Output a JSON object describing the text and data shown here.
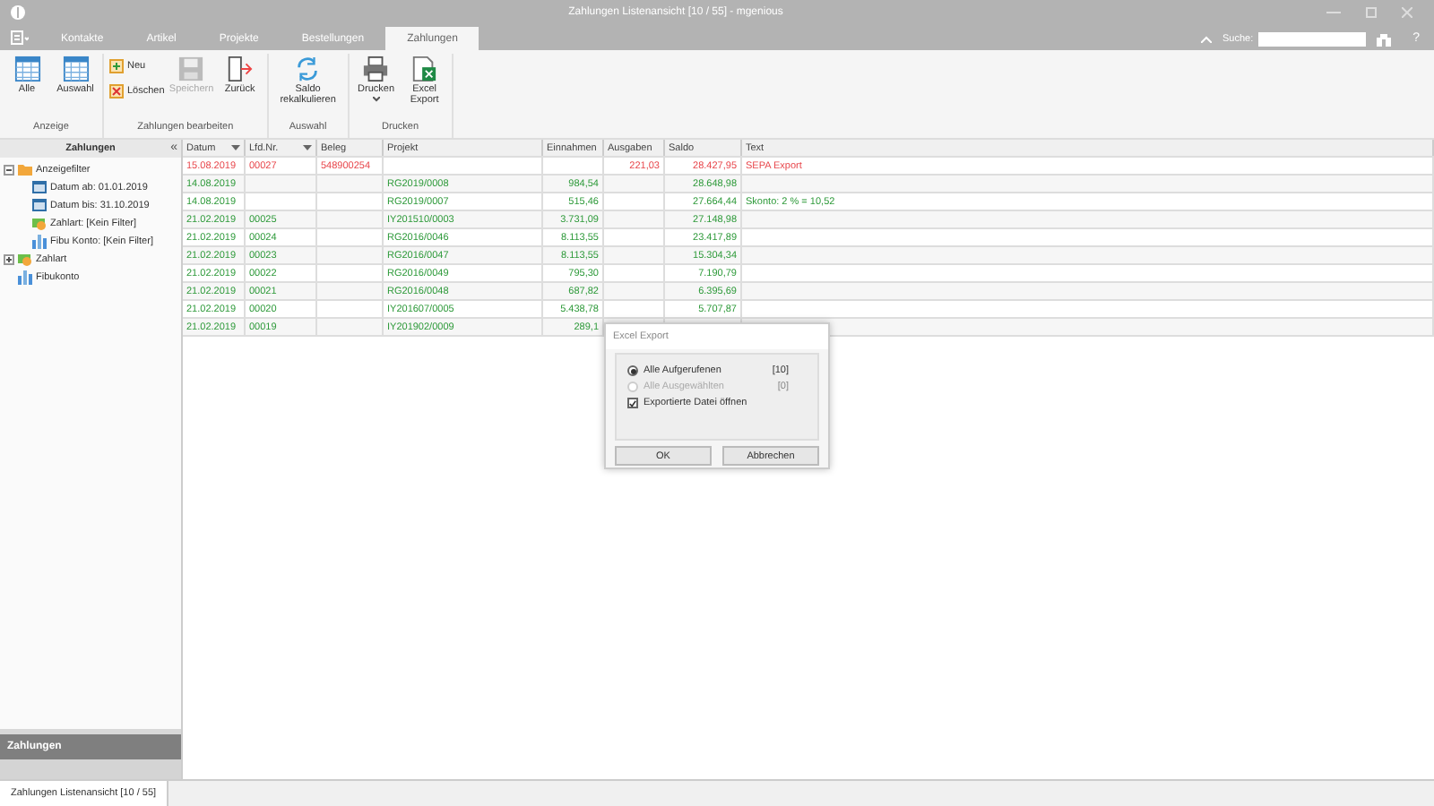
{
  "window": {
    "title": "Zahlungen Listenansicht [10 / 55] - mgenious"
  },
  "menu_tabs": [
    {
      "label": "Kontakte",
      "selected": false
    },
    {
      "label": "Artikel",
      "selected": false
    },
    {
      "label": "Projekte",
      "selected": false
    },
    {
      "label": "Bestellungen",
      "selected": false
    },
    {
      "label": "Zahlungen",
      "selected": true
    }
  ],
  "search": {
    "label": "Suche:"
  },
  "help": "?",
  "ribbon": [
    {
      "label": "Anzeige",
      "buttons": [
        {
          "label": "Alle",
          "kind": "large",
          "disabled": false
        },
        {
          "label": "Auswahl",
          "kind": "large",
          "disabled": false
        }
      ]
    },
    {
      "label": "Zahlungen bearbeiten",
      "buttons": [
        {
          "label": "Neu",
          "kind": "small",
          "disabled": false
        },
        {
          "label": "Löschen",
          "kind": "small",
          "disabled": false
        },
        {
          "label": "Speichern",
          "kind": "large",
          "disabled": true
        },
        {
          "label": "Zurück",
          "kind": "large",
          "disabled": false
        }
      ]
    },
    {
      "label": "Auswahl",
      "buttons": [
        {
          "label": "Saldo rekalkulieren",
          "kind": "large",
          "disabled": false
        }
      ]
    },
    {
      "label": "Drucken",
      "buttons": [
        {
          "label": "Drucken",
          "kind": "large",
          "disabled": false,
          "dropdown": true
        },
        {
          "label": "Excel Export",
          "kind": "large",
          "disabled": false
        }
      ]
    }
  ],
  "sidebar": {
    "title": "Zahlungen",
    "collapse": "«",
    "tree": [
      {
        "label": "Anzeigefilter",
        "expanded": true,
        "children": [
          {
            "label": "Datum ab: 01.01.2019"
          },
          {
            "label": "Datum bis: 31.10.2019"
          },
          {
            "label": "Zahlart: [Kein Filter]"
          },
          {
            "label": "Fibu Konto: [Kein Filter]"
          }
        ]
      },
      {
        "label": "Zahlart",
        "expanded": false
      },
      {
        "label": "Fibukonto"
      }
    ],
    "footer_title": "Zahlungen"
  },
  "table": {
    "columns": [
      {
        "label": "Datum",
        "filter": true
      },
      {
        "label": "Lfd.Nr.",
        "filter": true
      },
      {
        "label": "Beleg",
        "filter": false
      },
      {
        "label": "Projekt",
        "filter": false
      },
      {
        "label": "Einnahmen",
        "filter": false
      },
      {
        "label": "Ausgaben",
        "filter": false
      },
      {
        "label": "Saldo",
        "filter": false
      },
      {
        "label": "Text",
        "filter": false
      }
    ],
    "rows": [
      {
        "color": "#e8474c",
        "cells": [
          "15.08.2019",
          "00027",
          "548900254",
          "",
          "",
          "221,03",
          "28.427,95",
          "SEPA Export"
        ]
      },
      {
        "color": "#2e9a3a",
        "cells": [
          "14.08.2019",
          "",
          "",
          "RG2019/0008",
          "984,54",
          "",
          "28.648,98",
          ""
        ]
      },
      {
        "color": "#2e9a3a",
        "cells": [
          "14.08.2019",
          "",
          "",
          "RG2019/0007",
          "515,46",
          "",
          "27.664,44",
          "Skonto: 2 % = 10,52"
        ]
      },
      {
        "color": "#2e9a3a",
        "cells": [
          "21.02.2019",
          "00025",
          "",
          "IY201510/0003",
          "3.731,09",
          "",
          "27.148,98",
          ""
        ]
      },
      {
        "color": "#2e9a3a",
        "cells": [
          "21.02.2019",
          "00024",
          "",
          "RG2016/0046",
          "8.113,55",
          "",
          "23.417,89",
          ""
        ]
      },
      {
        "color": "#2e9a3a",
        "cells": [
          "21.02.2019",
          "00023",
          "",
          "RG2016/0047",
          "8.113,55",
          "",
          "15.304,34",
          ""
        ]
      },
      {
        "color": "#2e9a3a",
        "cells": [
          "21.02.2019",
          "00022",
          "",
          "RG2016/0049",
          "795,30",
          "",
          "7.190,79",
          ""
        ]
      },
      {
        "color": "#2e9a3a",
        "cells": [
          "21.02.2019",
          "00021",
          "",
          "RG2016/0048",
          "687,82",
          "",
          "6.395,69",
          ""
        ]
      },
      {
        "color": "#2e9a3a",
        "cells": [
          "21.02.2019",
          "00020",
          "",
          "IY201607/0005",
          "5.438,78",
          "",
          "5.707,87",
          ""
        ]
      },
      {
        "color": "#2e9a3a",
        "cells": [
          "21.02.2019",
          "00019",
          "",
          "IY201902/0009",
          "289,1",
          "",
          "",
          ""
        ]
      }
    ]
  },
  "dialog": {
    "title": "Excel Export",
    "options": [
      {
        "label": "Alle Aufgerufenen",
        "count": "[10]",
        "selected": true,
        "disabled": false
      },
      {
        "label": "Alle Ausgewählten",
        "count": "[0]",
        "selected": false,
        "disabled": true
      }
    ],
    "checkbox": {
      "label": "Exportierte Datei öffnen",
      "checked": true
    },
    "buttons": [
      "OK",
      "Abbrechen"
    ]
  },
  "status_bar": {
    "tab": "Zahlungen Listenansicht [10 / 55]"
  }
}
